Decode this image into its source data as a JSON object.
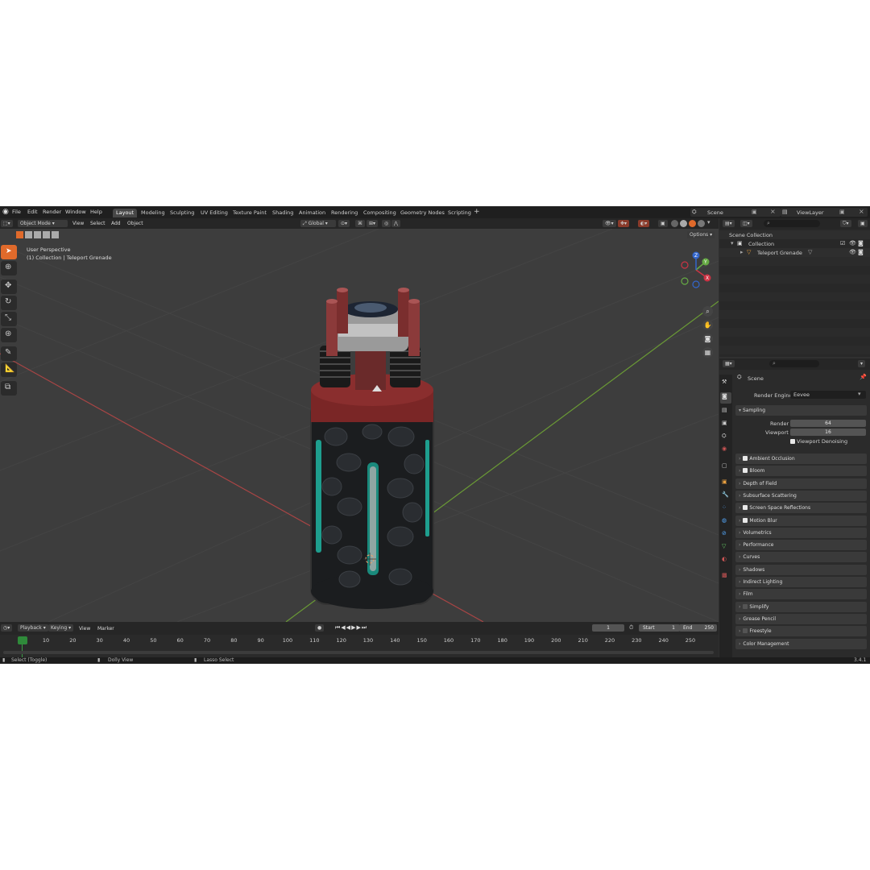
{
  "menu": [
    "File",
    "Edit",
    "Render",
    "Window",
    "Help"
  ],
  "workspaces": [
    {
      "label": "Layout",
      "active": true
    },
    {
      "label": "Modeling"
    },
    {
      "label": "Sculpting"
    },
    {
      "label": "UV Editing"
    },
    {
      "label": "Texture Paint"
    },
    {
      "label": "Shading"
    },
    {
      "label": "Animation"
    },
    {
      "label": "Rendering"
    },
    {
      "label": "Compositing"
    },
    {
      "label": "Geometry Nodes"
    },
    {
      "label": "Scripting"
    }
  ],
  "scene_name": "Scene",
  "view_layer": "ViewLayer",
  "viewport_header": {
    "mode": "Object Mode",
    "view": "View",
    "select": "Select",
    "add": "Add",
    "object": "Object",
    "orientation": "Global",
    "options": "Options"
  },
  "viewport": {
    "perspective": "User Perspective",
    "selection": "(1) Collection | Teleport Grenade"
  },
  "outliner": {
    "root": "Scene Collection",
    "collection": "Collection",
    "object": "Teleport Grenade"
  },
  "properties": {
    "context": "Scene",
    "render_engine_label": "Render Engine",
    "render_engine": "Eevee",
    "sampling": "Sampling",
    "render_label": "Render",
    "render_value": "64",
    "viewport_label": "Viewport",
    "viewport_value": "16",
    "viewport_denoising": "Viewport Denoising",
    "panels": [
      {
        "label": "Ambient Occlusion",
        "checkbox": true,
        "checked": true
      },
      {
        "label": "Bloom",
        "checkbox": true,
        "checked": true
      },
      {
        "label": "Depth of Field"
      },
      {
        "label": "Subsurface Scattering"
      },
      {
        "label": "Screen Space Reflections",
        "checkbox": true,
        "checked": true
      },
      {
        "label": "Motion Blur",
        "checkbox": true,
        "checked": true
      },
      {
        "label": "Volumetrics"
      },
      {
        "label": "Performance"
      },
      {
        "label": "Curves"
      },
      {
        "label": "Shadows"
      },
      {
        "label": "Indirect Lighting"
      },
      {
        "label": "Film"
      },
      {
        "label": "Simplify",
        "checkbox": true,
        "checked": false
      },
      {
        "label": "Grease Pencil"
      },
      {
        "label": "Freestyle",
        "checkbox": true,
        "checked": false
      },
      {
        "label": "Color Management"
      }
    ]
  },
  "timeline": {
    "playback": "Playback",
    "keying": "Keying",
    "view": "View",
    "marker": "Marker",
    "current_frame": "1",
    "start_label": "Start",
    "start": "1",
    "end_label": "End",
    "end": "250",
    "ticks": [
      "1",
      "10",
      "20",
      "30",
      "40",
      "50",
      "60",
      "70",
      "80",
      "90",
      "100",
      "110",
      "120",
      "130",
      "140",
      "150",
      "160",
      "170",
      "180",
      "190",
      "200",
      "210",
      "220",
      "230",
      "240",
      "250"
    ]
  },
  "status": {
    "select": "Select (Toggle)",
    "dolly": "Dolly View",
    "lasso": "Lasso Select",
    "version": "3.4.1"
  },
  "colors": {
    "accent": "#e06a2b",
    "grid_x": "#a84545",
    "grid_y": "#6a9a35",
    "teal": "#1e9e8e",
    "red_cap": "#7a2626"
  }
}
